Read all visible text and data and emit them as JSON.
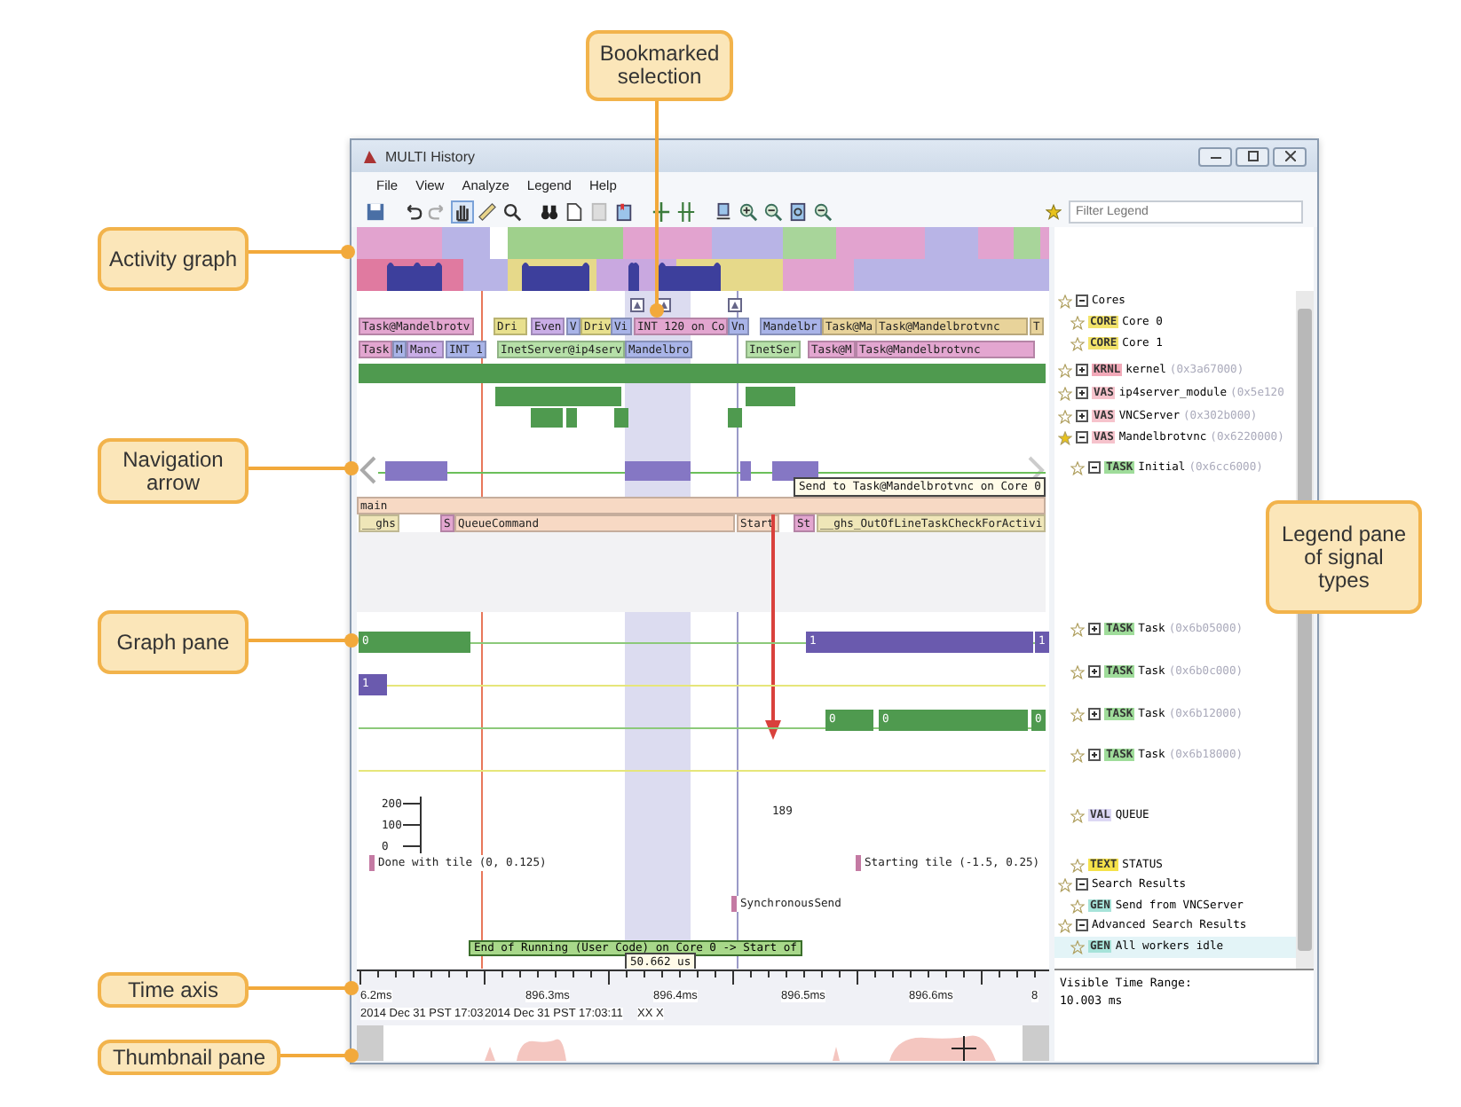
{
  "callouts": [
    {
      "text": "Activity graph"
    },
    {
      "text": "Bookmarked selection"
    },
    {
      "text": "Navigation arrow"
    },
    {
      "text": "Graph pane"
    },
    {
      "text": "Legend pane of signal types"
    },
    {
      "text": "Time axis"
    },
    {
      "text": "Thumbnail pane"
    }
  ],
  "window": {
    "title": "MULTI History"
  },
  "menu": [
    "File",
    "View",
    "Analyze",
    "Legend",
    "Help"
  ],
  "filter": {
    "placeholder": "Filter Legend"
  },
  "graph": {
    "task_rows": [
      [
        {
          "label": "Task@Mandelbrotv",
          "color": "#e3a6d0"
        },
        {
          "label": "Dri",
          "color": "#e8e08e"
        },
        {
          "label": "Even",
          "color": "#c9ade6"
        },
        {
          "label": "V",
          "color": "#a9b4e8"
        },
        {
          "label": "Driv",
          "color": "#e8e08e"
        },
        {
          "label": "Vi",
          "color": "#a9b4e8"
        },
        {
          "label": "INT 120 on Co",
          "color": "#e3a6d0"
        },
        {
          "label": "Vn",
          "color": "#a9b4e8"
        },
        {
          "label": "Mandelbr",
          "color": "#a9b4e8"
        },
        {
          "label": "Task@Ma",
          "color": "#e8d39a"
        },
        {
          "label": "Task@Mandelbrotvnc",
          "color": "#e8d39a"
        },
        {
          "label": "T",
          "color": "#e8d39a"
        }
      ],
      [
        {
          "label": "Task",
          "color": "#e3a6d0"
        },
        {
          "label": "M",
          "color": "#a9b4e8"
        },
        {
          "label": "Manc",
          "color": "#c9ade6"
        },
        {
          "label": "INT 1",
          "color": "#a9b4e8"
        },
        {
          "label": "InetServer@ip4serv",
          "color": "#b6e0a8"
        },
        {
          "label": "Mandelbro",
          "color": "#a9b4e8"
        },
        {
          "label": "InetSer",
          "color": "#b6e0a8"
        },
        {
          "label": "Task@M",
          "color": "#e3a6d0"
        },
        {
          "label": "Task@Mandelbrotvnc",
          "color": "#e3a6d0"
        }
      ]
    ],
    "nav_tooltip": "Send to Task@Mandelbrotvnc on Core 0",
    "call_stack": [
      {
        "label": "main",
        "color": "#f7d9c4"
      },
      {
        "label": "__ghs",
        "color": "#efe6b8"
      },
      {
        "label": "S",
        "color": "#e3a6d0"
      },
      {
        "label": "QueueCommand",
        "color": "#f7d9c4"
      },
      {
        "label": "Start",
        "color": "#f7d9c4"
      },
      {
        "label": "St",
        "color": "#e3a6d0"
      },
      {
        "label": "__ghs_OutOfLineTaskCheckForActivi",
        "color": "#efe6b8"
      }
    ],
    "signals": [
      {
        "label": "0",
        "color": "#4f9a4f"
      },
      {
        "label": "1",
        "color": "#6a5aae"
      },
      {
        "label": "1",
        "color": "#6a5aae"
      },
      {
        "label": "1",
        "color": "#6a5aae"
      },
      {
        "label": "0",
        "color": "#4f9a4f"
      },
      {
        "label": "0",
        "color": "#4f9a4f"
      },
      {
        "label": "0",
        "color": "#4f9a4f"
      }
    ],
    "queue": {
      "ticks": [
        "200",
        "100",
        "0"
      ],
      "value": "189"
    },
    "status_texts": [
      "Done with tile (0, 0.125)",
      "Starting tile (-1.5, 0.25)",
      "SynchronousSend"
    ],
    "hover_tooltip": "End of Running (User Code) on Core 0 -> Start of",
    "measurement": "50.662 us"
  },
  "time_axis": {
    "labels": [
      "6.2ms",
      "896.3ms",
      "896.4ms",
      "896.5ms",
      "896.6ms",
      "8"
    ],
    "dates": [
      "2014 Dec 31 PST 17:03",
      "2014 Dec 31 PST 17:03:11",
      "XX X"
    ]
  },
  "legend": [
    {
      "name": "Cores",
      "expanded": true,
      "starred": false,
      "selected": false,
      "children": [
        {
          "name": "Core 0",
          "tag": "CORE",
          "color": "#f2e36b",
          "starred": false,
          "selected": false
        },
        {
          "name": "Core 1",
          "tag": "CORE",
          "color": "#f2e36b",
          "starred": false,
          "selected": false
        }
      ]
    },
    {
      "name": "kernel",
      "tag": "KRNL",
      "color": "#f2a9b8",
      "address": "(0x3a67000)",
      "expanded": false,
      "starred": false,
      "selected": false
    },
    {
      "name": "ip4server_module",
      "tag": "VAS",
      "color": "#f6c3cc",
      "address": "(0x5e120",
      "expanded": false,
      "starred": false,
      "selected": false
    },
    {
      "name": "VNCServer",
      "tag": "VAS",
      "color": "#f6c3cc",
      "address": "(0x302b000)",
      "expanded": false,
      "starred": false,
      "selected": false
    },
    {
      "name": "Mandelbrotvnc",
      "tag": "VAS",
      "color": "#f6c3cc",
      "address": "(0x6220000)",
      "expanded": true,
      "starred": true,
      "selected": false,
      "children": [
        {
          "name": "Initial",
          "tag": "TASK",
          "color": "#9fdc9a",
          "address": "(0x6cc6000)",
          "expanded": true,
          "starred": false,
          "selected": false
        },
        {
          "name": "Task",
          "tag": "TASK",
          "color": "#9fdc9a",
          "address": "(0x6b05000)",
          "expanded": false,
          "starred": false,
          "selected": false
        },
        {
          "name": "Task",
          "tag": "TASK",
          "color": "#9fdc9a",
          "address": "(0x6b0c000)",
          "expanded": false,
          "starred": false,
          "selected": false
        },
        {
          "name": "Task",
          "tag": "TASK",
          "color": "#9fdc9a",
          "address": "(0x6b12000)",
          "expanded": false,
          "starred": false,
          "selected": false
        },
        {
          "name": "Task",
          "tag": "TASK",
          "color": "#9fdc9a",
          "address": "(0x6b18000)",
          "expanded": false,
          "starred": false,
          "selected": false
        },
        {
          "name": "QUEUE",
          "tag": "VAL",
          "color": "#dcd8f4",
          "starred": false,
          "selected": false
        },
        {
          "name": "STATUS",
          "tag": "TEXT",
          "color": "#f5e24a",
          "starred": false,
          "selected": false
        }
      ]
    },
    {
      "name": "Search Results",
      "expanded": true,
      "starred": false,
      "selected": false,
      "children": [
        {
          "name": "Send from VNCServer",
          "tag": "GEN",
          "color": "#a6e3d9",
          "starred": false,
          "selected": false
        }
      ]
    },
    {
      "name": "Advanced Search Results",
      "expanded": true,
      "starred": false,
      "selected": false,
      "children": [
        {
          "name": "All workers idle",
          "tag": "GEN",
          "color": "#a6e3d9",
          "starred": false,
          "selected": true
        }
      ]
    }
  ],
  "visible_range": {
    "label": "Visible Time Range:",
    "value": "10.003 ms"
  }
}
